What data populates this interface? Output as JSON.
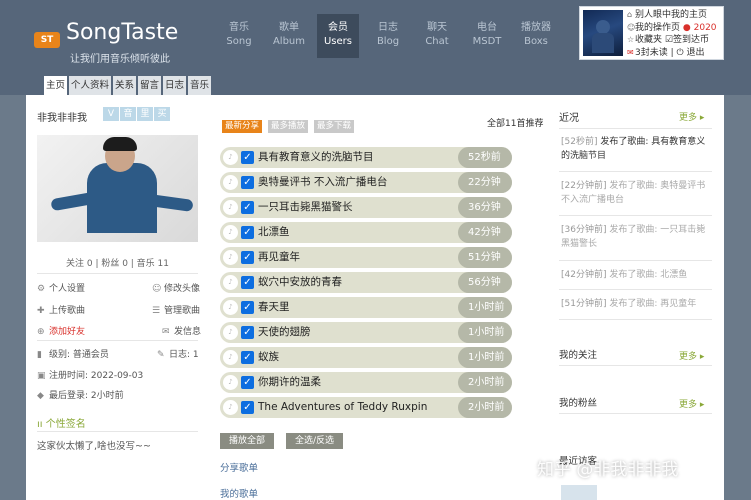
{
  "brand": {
    "badge": "ST",
    "name": "SongTaste",
    "slogan": "让我们用音乐倾听彼此"
  },
  "nav": [
    {
      "cn": "音乐",
      "en": "Song"
    },
    {
      "cn": "歌单",
      "en": "Album"
    },
    {
      "cn": "会员",
      "en": "Users"
    },
    {
      "cn": "日志",
      "en": "Blog"
    },
    {
      "cn": "聊天",
      "en": "Chat"
    },
    {
      "cn": "电台",
      "en": "MSDT"
    },
    {
      "cn": "播放器",
      "en": "Boxs"
    }
  ],
  "user_menu": {
    "my_home_in_others": "别人眼中我的主页",
    "my_actions": "我的操作页",
    "points": "2020",
    "favorites": "收藏夹",
    "sign_in": "签到达币",
    "unread": "3封未读",
    "logout": "退出"
  },
  "profile_tabs": [
    "主页",
    "个人资料",
    "关系",
    "留言",
    "日志",
    "音乐"
  ],
  "profile": {
    "name": "非我非非我",
    "badges": [
      "V",
      "音",
      "里",
      "买"
    ],
    "stats": "关注 0 | 粉丝 0 | 音乐 11",
    "actions": {
      "settings": "个人设置",
      "edit_avatar": "修改头像",
      "upload": "上传歌曲",
      "manage": "管理歌曲",
      "add_friend": "添加好友",
      "message": "发信息"
    },
    "level_label": "级别:",
    "level_value": "普通会员",
    "blog_label": "日志:",
    "blog_value": "1",
    "register_label": "注册时间:",
    "register_value": "2022-09-03",
    "last_login_label": "最后登录:",
    "last_login_value": "2小时前",
    "signature_title": "个性签名",
    "signature_text": "这家伙太懒了,啥也没写~~"
  },
  "song_filters": [
    "最新分享",
    "最多播放",
    "最多下载"
  ],
  "recommend_count": "全部11首推荐",
  "songs": [
    {
      "title": "具有教育意义的洗脑节目",
      "time": "52秒前"
    },
    {
      "title": "奥特曼评书 不入流广播电台",
      "time": "22分钟"
    },
    {
      "title": "一只耳击毙黑猫警长",
      "time": "36分钟"
    },
    {
      "title": "北漂鱼",
      "time": "42分钟"
    },
    {
      "title": "再见童年",
      "time": "51分钟"
    },
    {
      "title": "蚁穴中安放的青春",
      "time": "56分钟"
    },
    {
      "title": "春天里",
      "time": "1小时前"
    },
    {
      "title": "天使的翅膀",
      "time": "1小时前"
    },
    {
      "title": "蚁族",
      "time": "1小时前"
    },
    {
      "title": "你期许的温柔",
      "time": "2小时前"
    },
    {
      "title": "The Adventures of Teddy Ruxpin",
      "time": "2小时前"
    }
  ],
  "play_all": "播放全部",
  "select_toggle": "全选/反选",
  "share_list_link": "分享歌单",
  "my_songs_link": "我的歌单",
  "right": {
    "recent_title": "近况",
    "more": "更多",
    "feed": [
      {
        "time": "[52秒前]",
        "action": "发布了歌曲:",
        "song": "具有教育意义的洗脑节目"
      },
      {
        "time": "[22分钟前]",
        "action": "发布了歌曲:",
        "song": "奥特曼评书 不入流广播电台"
      },
      {
        "time": "[36分钟前]",
        "action": "发布了歌曲:",
        "song": "一只耳击毙黑猫警长"
      },
      {
        "time": "[42分钟前]",
        "action": "发布了歌曲:",
        "song": "北漂鱼"
      },
      {
        "time": "[51分钟前]",
        "action": "发布了歌曲:",
        "song": "再见童年"
      }
    ],
    "following_title": "我的关注",
    "fans_title": "我的粉丝",
    "latest_title": "最近访客"
  },
  "watermark": "知乎 @非我非非我",
  "colors": {
    "topbar": "#56667a",
    "accent_orange": "#e8841a",
    "accent_green": "#8aa838",
    "checkbox_blue": "#0d6ee0",
    "song_bar": "#dfe0cf"
  }
}
